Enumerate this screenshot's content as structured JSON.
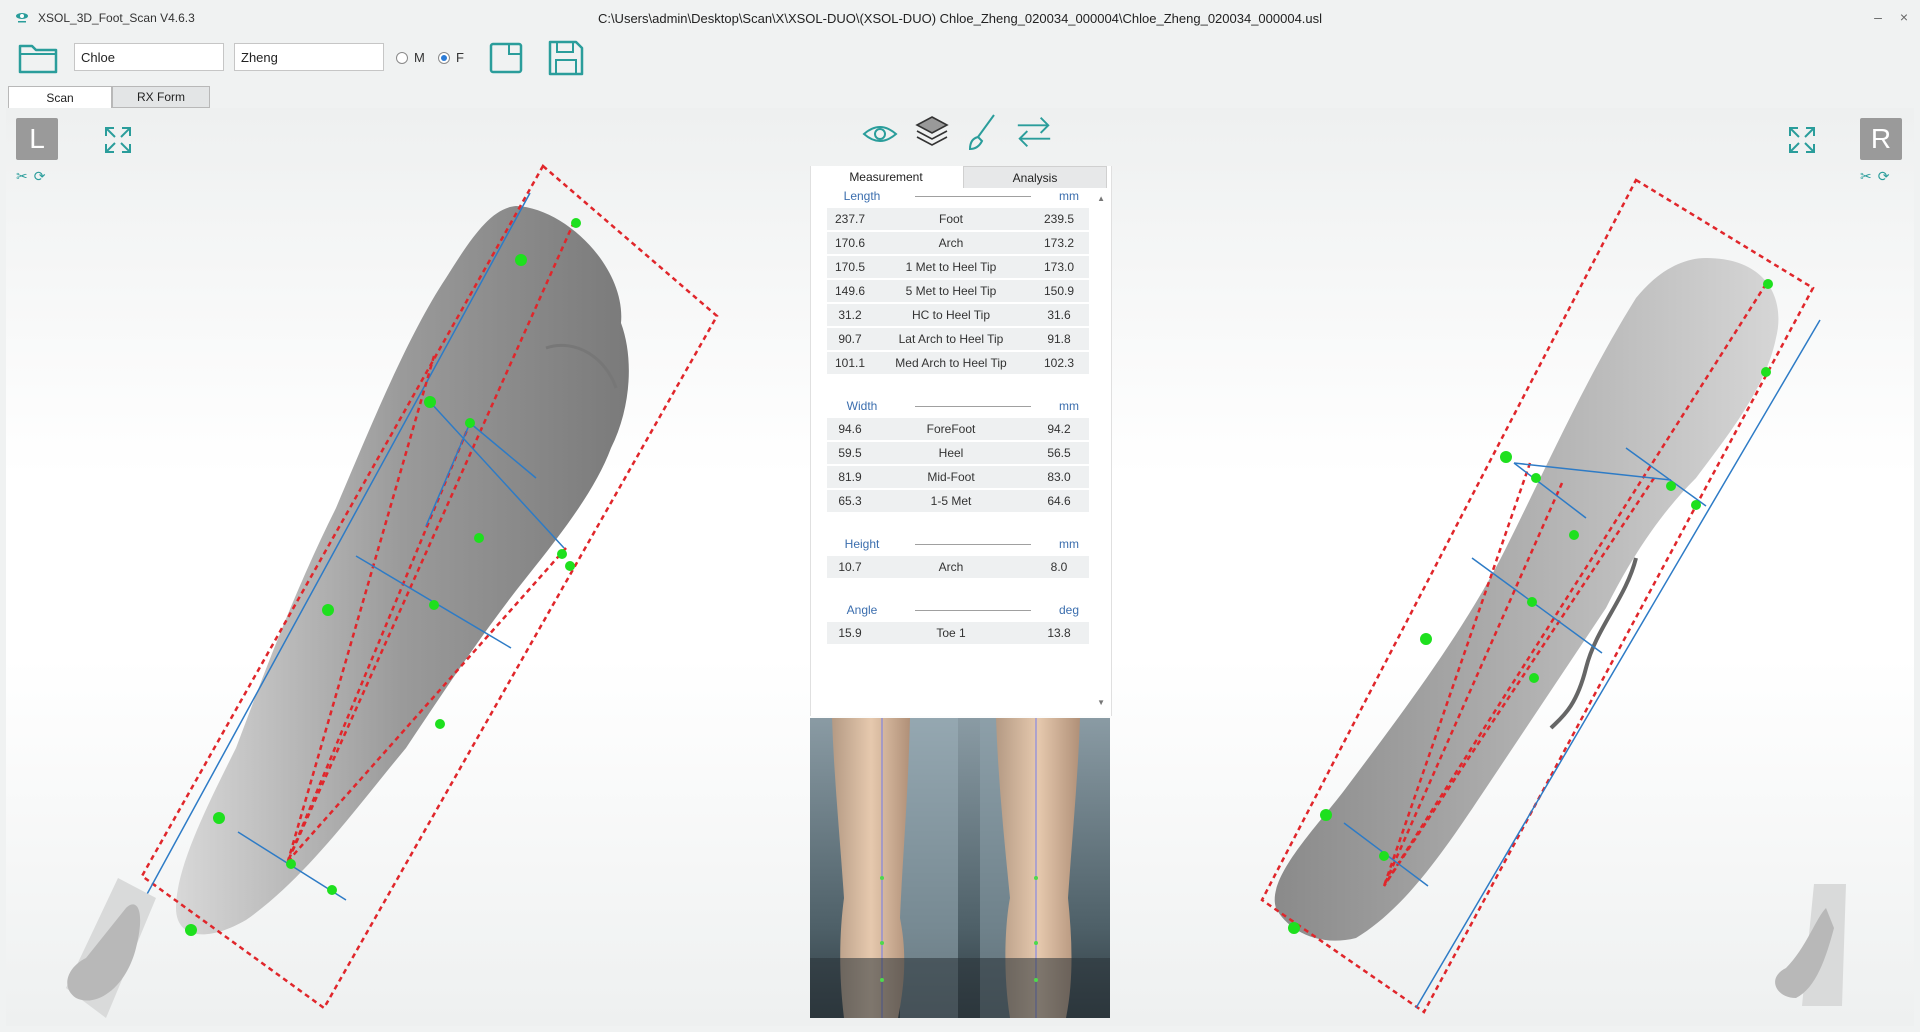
{
  "window": {
    "app_title": "XSOL_3D_Foot_Scan V4.6.3",
    "file_path": "C:\\Users\\admin\\Desktop\\Scan\\X\\XSOL-DUO\\(XSOL-DUO) Chloe_Zheng_020034_000004\\Chloe_Zheng_020034_000004.usl",
    "controls": {
      "minimize": "–",
      "close": "×"
    }
  },
  "toolbar": {
    "first_name": "Chloe",
    "last_name": "Zheng",
    "gender_options": [
      {
        "label": "M",
        "checked": false
      },
      {
        "label": "F",
        "checked": true
      }
    ],
    "icons": [
      "open-folder-icon",
      "new-document-icon",
      "save-icon"
    ]
  },
  "tabs": [
    {
      "label": "Scan",
      "active": true
    },
    {
      "label": "RX Form",
      "active": false
    }
  ],
  "left_view": {
    "badge": "L"
  },
  "right_view": {
    "badge": "R"
  },
  "view_icons": [
    "eye-icon",
    "layers-icon",
    "brush-icon",
    "swap-icon"
  ],
  "panel": {
    "tabs": [
      {
        "label": "Measurement",
        "active": true
      },
      {
        "label": "Analysis",
        "active": false
      }
    ],
    "sections": [
      {
        "name": "Length",
        "unit": "mm",
        "rows": [
          {
            "left": "237.7",
            "label": "Foot",
            "right": "239.5"
          },
          {
            "left": "170.6",
            "label": "Arch",
            "right": "173.2"
          },
          {
            "left": "170.5",
            "label": "1 Met to Heel Tip",
            "right": "173.0"
          },
          {
            "left": "149.6",
            "label": "5 Met to Heel Tip",
            "right": "150.9"
          },
          {
            "left": "31.2",
            "label": "HC to Heel Tip",
            "right": "31.6"
          },
          {
            "left": "90.7",
            "label": "Lat Arch to Heel Tip",
            "right": "91.8"
          },
          {
            "left": "101.1",
            "label": "Med Arch to Heel Tip",
            "right": "102.3"
          }
        ]
      },
      {
        "name": "Width",
        "unit": "mm",
        "rows": [
          {
            "left": "94.6",
            "label": "ForeFoot",
            "right": "94.2"
          },
          {
            "left": "59.5",
            "label": "Heel",
            "right": "56.5"
          },
          {
            "left": "81.9",
            "label": "Mid-Foot",
            "right": "83.0"
          },
          {
            "left": "65.3",
            "label": "1-5 Met",
            "right": "64.6"
          }
        ]
      },
      {
        "name": "Height",
        "unit": "mm",
        "rows": [
          {
            "left": "10.7",
            "label": "Arch",
            "right": "8.0"
          }
        ]
      },
      {
        "name": "Angle",
        "unit": "deg",
        "rows": [
          {
            "left": "15.9",
            "label": "Toe 1",
            "right": "13.8"
          }
        ]
      }
    ]
  },
  "colors": {
    "accent": "#2a9d9b",
    "bbox_red": "#e0262b",
    "axis_blue": "#2d7bc6",
    "marker_green": "#1ee01e",
    "section_text": "#3b6eae"
  }
}
